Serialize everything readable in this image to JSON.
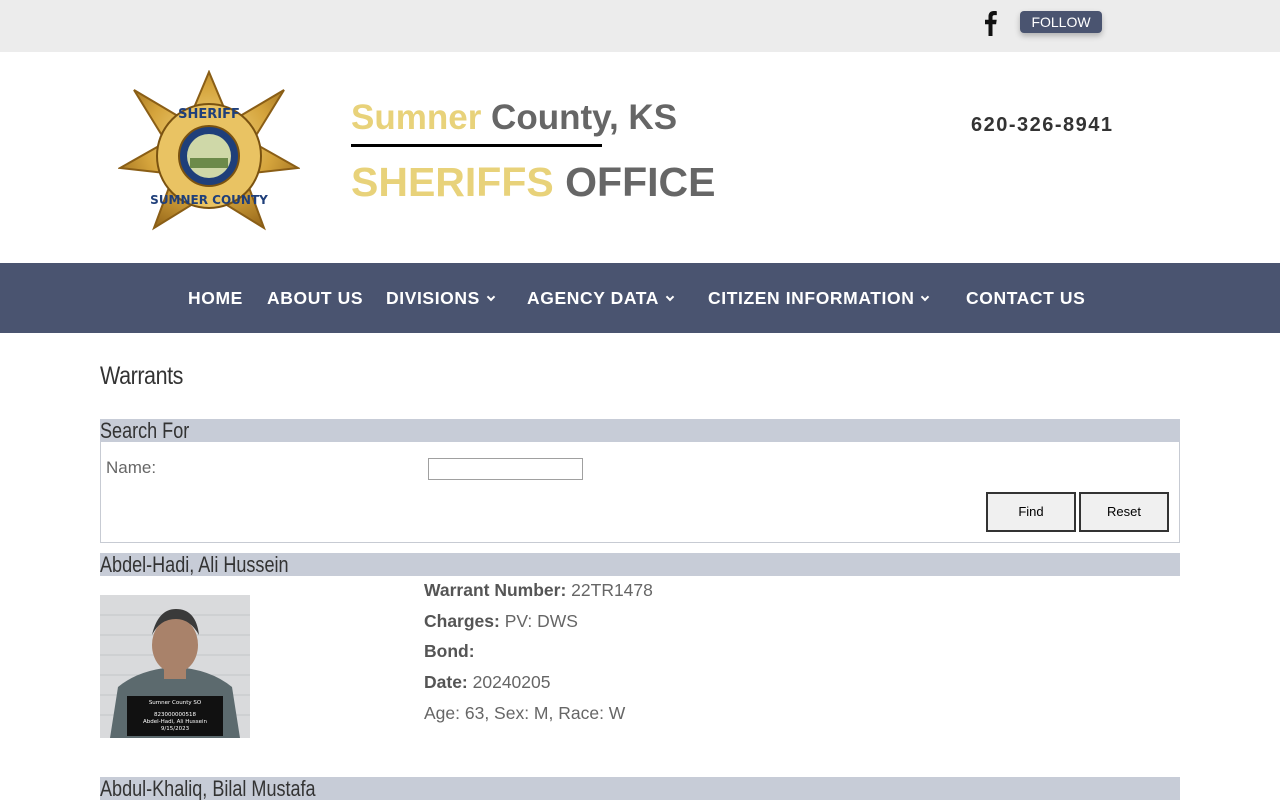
{
  "topbar": {
    "social_icon": "facebook-icon",
    "follow_label": "FOLLOW"
  },
  "header": {
    "badge_icon": "sheriff-star-badge",
    "title_gold_1": "Sumner",
    "title_grey_1": " County, KS",
    "title_gold_2": "SHERIFFS",
    "title_grey_2": " OFFICE",
    "phone": "620-326-8941"
  },
  "nav": {
    "items": [
      {
        "label": "HOME"
      },
      {
        "label": "ABOUT US"
      },
      {
        "label": "DIVISIONS"
      },
      {
        "label": "AGENCY DATA"
      },
      {
        "label": "CITIZEN INFORMATION"
      },
      {
        "label": "CONTACT US"
      }
    ]
  },
  "main": {
    "page_title": "Warrants",
    "search": {
      "heading": "Search For",
      "name_label": "Name:",
      "name_value": "",
      "find_label": "Find",
      "reset_label": "Reset"
    },
    "records": [
      {
        "name": "Abdel-Hadi, Ali Hussein",
        "warrant_label": "Warrant Number:",
        "warrant_value": " 22TR1478",
        "charges_label": "Charges:",
        "charges_value": " PV: DWS",
        "bond_label": "Bond:",
        "bond_value": "",
        "date_label": "Date:",
        "date_value": " 20240205",
        "demographics": "Age: 63, Sex: M, Race: W",
        "placard": {
          "line1": "Sumner County SO",
          "line2": "823000000518",
          "line3": "Abdel-Hadi, Ali Hussein",
          "line4": "9/15/2023"
        }
      },
      {
        "name": "Abdul-Khaliq, Bilal Mustafa"
      }
    ]
  },
  "colors": {
    "nav_bg": "#4a5470",
    "gold": "#e8d27a",
    "section_bar": "#c7ccd7"
  }
}
